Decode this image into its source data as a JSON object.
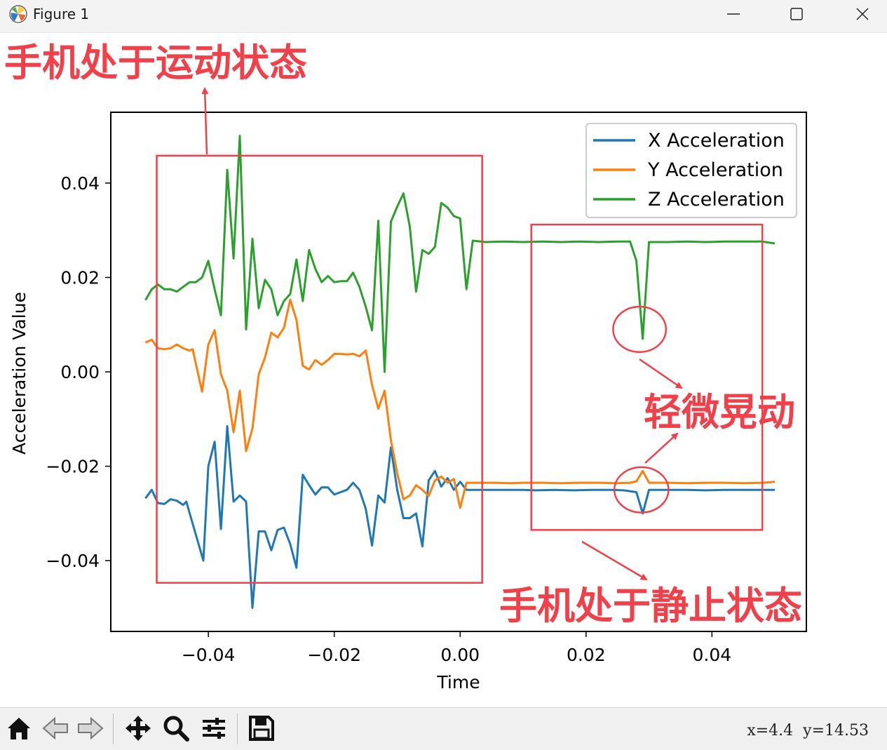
{
  "window": {
    "title": "Figure 1",
    "icons": {
      "app": "matplotlib-logo-icon",
      "minimize": "minimize-icon",
      "maximize": "maximize-icon",
      "close": "close-icon"
    }
  },
  "annotations": {
    "moving_label": "手机处于运动状态",
    "slight_shake_label": "轻微晃动",
    "static_label": "手机处于静止状态",
    "color": "#f0414a"
  },
  "toolbar": {
    "icons": [
      "home-icon",
      "back-arrow-icon",
      "forward-arrow-icon",
      "pan-move-icon",
      "zoom-magnifier-icon",
      "configure-subplots-icon",
      "save-floppy-icon"
    ],
    "coords": {
      "x_label": "x=4.4",
      "y_label": "y=14.53"
    }
  },
  "chart_data": {
    "type": "line",
    "xlabel": "Time",
    "ylabel": "Acceleration Value",
    "xlim": [
      -0.0555,
      0.055
    ],
    "ylim": [
      -0.055,
      0.055
    ],
    "xticks": [
      -0.04,
      -0.02,
      0.0,
      0.02,
      0.04
    ],
    "xtick_labels": [
      "−0.04",
      "−0.02",
      "0.00",
      "0.02",
      "0.04"
    ],
    "yticks": [
      0.04,
      0.02,
      0.0,
      -0.02,
      -0.04
    ],
    "ytick_labels": [
      "0.04",
      "0.02",
      "0.00",
      "−0.02",
      "−0.04"
    ],
    "legend_position": "upper-right",
    "grid": false,
    "series": [
      {
        "name": "X Acceleration",
        "color": "#1f77b4",
        "points": [
          [
            -0.05,
            -0.0268
          ],
          [
            -0.049,
            -0.025
          ],
          [
            -0.048,
            -0.0278
          ],
          [
            -0.047,
            -0.028
          ],
          [
            -0.046,
            -0.027
          ],
          [
            -0.045,
            -0.0273
          ],
          [
            -0.044,
            -0.0282
          ],
          [
            -0.0435,
            -0.0275
          ],
          [
            -0.0408,
            -0.04
          ],
          [
            -0.04,
            -0.02
          ],
          [
            -0.039,
            -0.0148
          ],
          [
            -0.038,
            -0.0333
          ],
          [
            -0.037,
            -0.0115
          ],
          [
            -0.036,
            -0.0275
          ],
          [
            -0.035,
            -0.0262
          ],
          [
            -0.034,
            -0.0275
          ],
          [
            -0.033,
            -0.05
          ],
          [
            -0.032,
            -0.0338
          ],
          [
            -0.031,
            -0.0338
          ],
          [
            -0.03,
            -0.0378
          ],
          [
            -0.029,
            -0.0335
          ],
          [
            -0.028,
            -0.033
          ],
          [
            -0.027,
            -0.0365
          ],
          [
            -0.026,
            -0.0415
          ],
          [
            -0.025,
            -0.0218
          ],
          [
            -0.024,
            -0.024
          ],
          [
            -0.023,
            -0.026
          ],
          [
            -0.022,
            -0.0245
          ],
          [
            -0.021,
            -0.0245
          ],
          [
            -0.02,
            -0.026
          ],
          [
            -0.019,
            -0.0255
          ],
          [
            -0.018,
            -0.025
          ],
          [
            -0.017,
            -0.0235
          ],
          [
            -0.016,
            -0.025
          ],
          [
            -0.015,
            -0.029
          ],
          [
            -0.014,
            -0.0368
          ],
          [
            -0.013,
            -0.0262
          ],
          [
            -0.012,
            -0.0277
          ],
          [
            -0.011,
            -0.016
          ],
          [
            -0.01,
            -0.025
          ],
          [
            -0.009,
            -0.031
          ],
          [
            -0.008,
            -0.031
          ],
          [
            -0.007,
            -0.03
          ],
          [
            -0.006,
            -0.037
          ],
          [
            -0.005,
            -0.023
          ],
          [
            -0.004,
            -0.021
          ],
          [
            -0.003,
            -0.0243
          ],
          [
            -0.002,
            -0.0225
          ],
          [
            -0.001,
            -0.025
          ],
          [
            0.0,
            -0.0233
          ],
          [
            0.001,
            -0.025
          ],
          [
            0.003,
            -0.025
          ],
          [
            0.005,
            -0.025
          ],
          [
            0.008,
            -0.025
          ],
          [
            0.01,
            -0.025
          ],
          [
            0.012,
            -0.0251
          ],
          [
            0.015,
            -0.025
          ],
          [
            0.018,
            -0.0251
          ],
          [
            0.021,
            -0.025
          ],
          [
            0.024,
            -0.025
          ],
          [
            0.026,
            -0.0251
          ],
          [
            0.028,
            -0.0255
          ],
          [
            0.029,
            -0.03
          ],
          [
            0.03,
            -0.025
          ],
          [
            0.033,
            -0.025
          ],
          [
            0.036,
            -0.025
          ],
          [
            0.039,
            -0.0251
          ],
          [
            0.042,
            -0.025
          ],
          [
            0.045,
            -0.025
          ],
          [
            0.048,
            -0.025
          ],
          [
            0.05,
            -0.025
          ]
        ]
      },
      {
        "name": "Y Acceleration",
        "color": "#ff7f0e",
        "points": [
          [
            -0.05,
            0.0062
          ],
          [
            -0.049,
            0.0068
          ],
          [
            -0.048,
            0.005
          ],
          [
            -0.047,
            0.0048
          ],
          [
            -0.046,
            0.005
          ],
          [
            -0.045,
            0.0058
          ],
          [
            -0.044,
            0.005
          ],
          [
            -0.043,
            0.0045
          ],
          [
            -0.0425,
            0.0048
          ],
          [
            -0.041,
            -0.0042
          ],
          [
            -0.04,
            0.0058
          ],
          [
            -0.039,
            0.0088
          ],
          [
            -0.038,
            -0.0005
          ],
          [
            -0.037,
            -0.004
          ],
          [
            -0.036,
            -0.0128
          ],
          [
            -0.035,
            -0.004
          ],
          [
            -0.034,
            -0.0168
          ],
          [
            -0.033,
            -0.012
          ],
          [
            -0.032,
            -0.0005
          ],
          [
            -0.031,
            0.003
          ],
          [
            -0.03,
            0.0083
          ],
          [
            -0.029,
            0.0073
          ],
          [
            -0.028,
            0.0093
          ],
          [
            -0.027,
            0.0153
          ],
          [
            -0.026,
            0.011
          ],
          [
            -0.025,
            0.0013
          ],
          [
            -0.024,
            0.0005
          ],
          [
            -0.023,
            0.0025
          ],
          [
            -0.022,
            0.0015
          ],
          [
            -0.021,
            0.0025
          ],
          [
            -0.02,
            0.0038
          ],
          [
            -0.019,
            0.0038
          ],
          [
            -0.018,
            0.0037
          ],
          [
            -0.017,
            0.0038
          ],
          [
            -0.016,
            0.0033
          ],
          [
            -0.015,
            0.0045
          ],
          [
            -0.014,
            -0.0028
          ],
          [
            -0.013,
            -0.0078
          ],
          [
            -0.012,
            -0.004
          ],
          [
            -0.011,
            -0.0145
          ],
          [
            -0.01,
            -0.0215
          ],
          [
            -0.009,
            -0.027
          ],
          [
            -0.008,
            -0.0262
          ],
          [
            -0.007,
            -0.024
          ],
          [
            -0.006,
            -0.025
          ],
          [
            -0.005,
            -0.0263
          ],
          [
            -0.004,
            -0.023
          ],
          [
            -0.003,
            -0.0222
          ],
          [
            -0.002,
            -0.0235
          ],
          [
            -0.001,
            -0.0227
          ],
          [
            0.0,
            -0.0288
          ],
          [
            0.001,
            -0.0235
          ],
          [
            0.003,
            -0.0235
          ],
          [
            0.005,
            -0.0235
          ],
          [
            0.008,
            -0.0236
          ],
          [
            0.01,
            -0.0235
          ],
          [
            0.013,
            -0.0235
          ],
          [
            0.016,
            -0.0236
          ],
          [
            0.019,
            -0.0235
          ],
          [
            0.022,
            -0.0235
          ],
          [
            0.025,
            -0.0236
          ],
          [
            0.027,
            -0.0235
          ],
          [
            0.028,
            -0.0232
          ],
          [
            0.029,
            -0.021
          ],
          [
            0.03,
            -0.0235
          ],
          [
            0.033,
            -0.0235
          ],
          [
            0.036,
            -0.0236
          ],
          [
            0.039,
            -0.0235
          ],
          [
            0.042,
            -0.0235
          ],
          [
            0.045,
            -0.0236
          ],
          [
            0.048,
            -0.0235
          ],
          [
            0.05,
            -0.0233
          ]
        ]
      },
      {
        "name": "Z Acceleration",
        "color": "#2ca02c",
        "points": [
          [
            -0.05,
            0.0152
          ],
          [
            -0.049,
            0.0175
          ],
          [
            -0.048,
            0.0185
          ],
          [
            -0.047,
            0.0175
          ],
          [
            -0.046,
            0.0175
          ],
          [
            -0.045,
            0.017
          ],
          [
            -0.044,
            0.018
          ],
          [
            -0.043,
            0.019
          ],
          [
            -0.042,
            0.019
          ],
          [
            -0.041,
            0.02
          ],
          [
            -0.04,
            0.0235
          ],
          [
            -0.039,
            0.0175
          ],
          [
            -0.038,
            0.012
          ],
          [
            -0.037,
            0.0428
          ],
          [
            -0.036,
            0.024
          ],
          [
            -0.035,
            0.05
          ],
          [
            -0.034,
            0.009
          ],
          [
            -0.033,
            0.0282
          ],
          [
            -0.032,
            0.0135
          ],
          [
            -0.031,
            0.0195
          ],
          [
            -0.03,
            0.0175
          ],
          [
            -0.029,
            0.012
          ],
          [
            -0.028,
            0.015
          ],
          [
            -0.027,
            0.0165
          ],
          [
            -0.026,
            0.0238
          ],
          [
            -0.025,
            0.015
          ],
          [
            -0.024,
            0.0258
          ],
          [
            -0.023,
            0.0218
          ],
          [
            -0.022,
            0.019
          ],
          [
            -0.021,
            0.0203
          ],
          [
            -0.02,
            0.019
          ],
          [
            -0.019,
            0.0192
          ],
          [
            -0.018,
            0.0192
          ],
          [
            -0.017,
            0.021
          ],
          [
            -0.016,
            0.018
          ],
          [
            -0.015,
            0.0138
          ],
          [
            -0.014,
            0.0088
          ],
          [
            -0.013,
            0.032
          ],
          [
            -0.012,
            0.0
          ],
          [
            -0.011,
            0.0318
          ],
          [
            -0.01,
            0.035
          ],
          [
            -0.009,
            0.0378
          ],
          [
            -0.008,
            0.0308
          ],
          [
            -0.007,
            0.017
          ],
          [
            -0.006,
            0.0258
          ],
          [
            -0.005,
            0.025
          ],
          [
            -0.004,
            0.0265
          ],
          [
            -0.003,
            0.0358
          ],
          [
            -0.002,
            0.0348
          ],
          [
            -0.001,
            0.033
          ],
          [
            0.0,
            0.0325
          ],
          [
            0.001,
            0.0175
          ],
          [
            0.002,
            0.0278
          ],
          [
            0.004,
            0.0275
          ],
          [
            0.007,
            0.0276
          ],
          [
            0.01,
            0.0275
          ],
          [
            0.013,
            0.0276
          ],
          [
            0.016,
            0.0275
          ],
          [
            0.019,
            0.0276
          ],
          [
            0.022,
            0.0275
          ],
          [
            0.025,
            0.0276
          ],
          [
            0.027,
            0.0276
          ],
          [
            0.028,
            0.0235
          ],
          [
            0.029,
            0.007
          ],
          [
            0.03,
            0.0275
          ],
          [
            0.033,
            0.0275
          ],
          [
            0.036,
            0.0276
          ],
          [
            0.039,
            0.0275
          ],
          [
            0.042,
            0.0276
          ],
          [
            0.045,
            0.0276
          ],
          [
            0.048,
            0.0276
          ],
          [
            0.05,
            0.0272
          ]
        ]
      }
    ],
    "annotation_boxes": [
      {
        "name": "moving-region-box",
        "x": [
          -0.0482,
          0.0035
        ],
        "y": [
          -0.0447,
          0.0458
        ]
      },
      {
        "name": "static-region-box",
        "x": [
          0.0113,
          0.048
        ],
        "y": [
          -0.0335,
          0.0312
        ]
      }
    ],
    "annotation_circles": [
      {
        "name": "z-shake-circle",
        "cx": 0.0285,
        "cy": 0.009,
        "rx": 0.0042,
        "ry": 0.0048
      },
      {
        "name": "xy-shake-circle",
        "cx": 0.0288,
        "cy": -0.025,
        "rx": 0.0043,
        "ry": 0.0048
      }
    ]
  }
}
